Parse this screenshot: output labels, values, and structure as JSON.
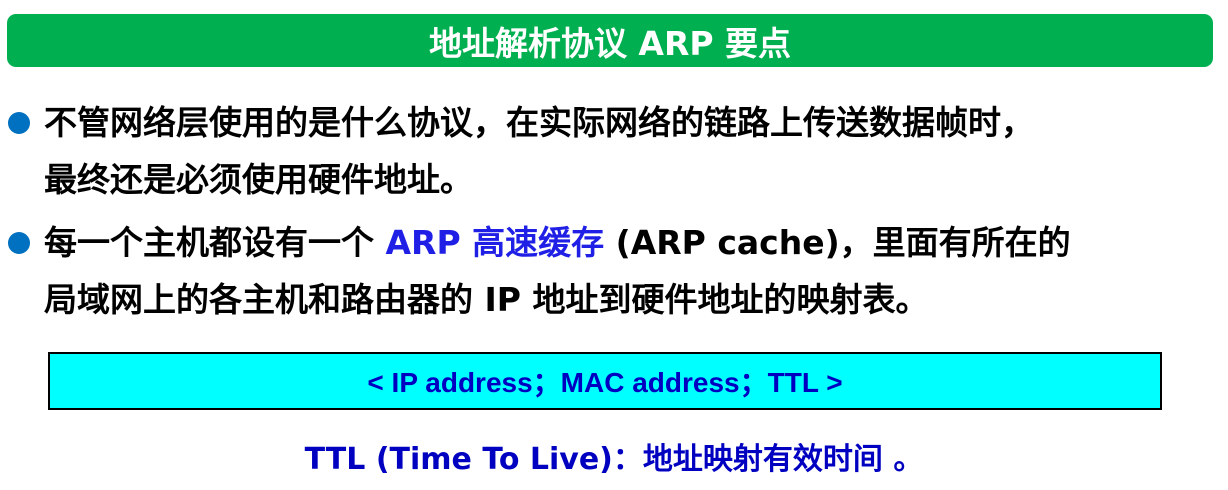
{
  "title": "地址解析协议 ARP 要点",
  "bullets": [
    {
      "lines": [
        "不管网络层使用的是什么协议，在实际网络的链路上传送数据帧时，",
        "最终还是必须使用硬件地址。"
      ]
    },
    {
      "line1_pre": "每一个主机都设有一个 ",
      "line1_highlight": "ARP 高速缓存",
      "line1_post": " (ARP cache)，里面有所在的",
      "line2": "局域网上的各主机和路由器的 IP 地址到硬件地址的映射表。"
    }
  ],
  "entry_format": "< IP address；MAC address；TTL >",
  "ttl_note": "TTL (Time To Live)：地址映射有效时间 。",
  "colors": {
    "title_bg": "#00b050",
    "bullet": "#0070c0",
    "box_bg": "#00ffff",
    "blue_text": "#0000c0"
  }
}
